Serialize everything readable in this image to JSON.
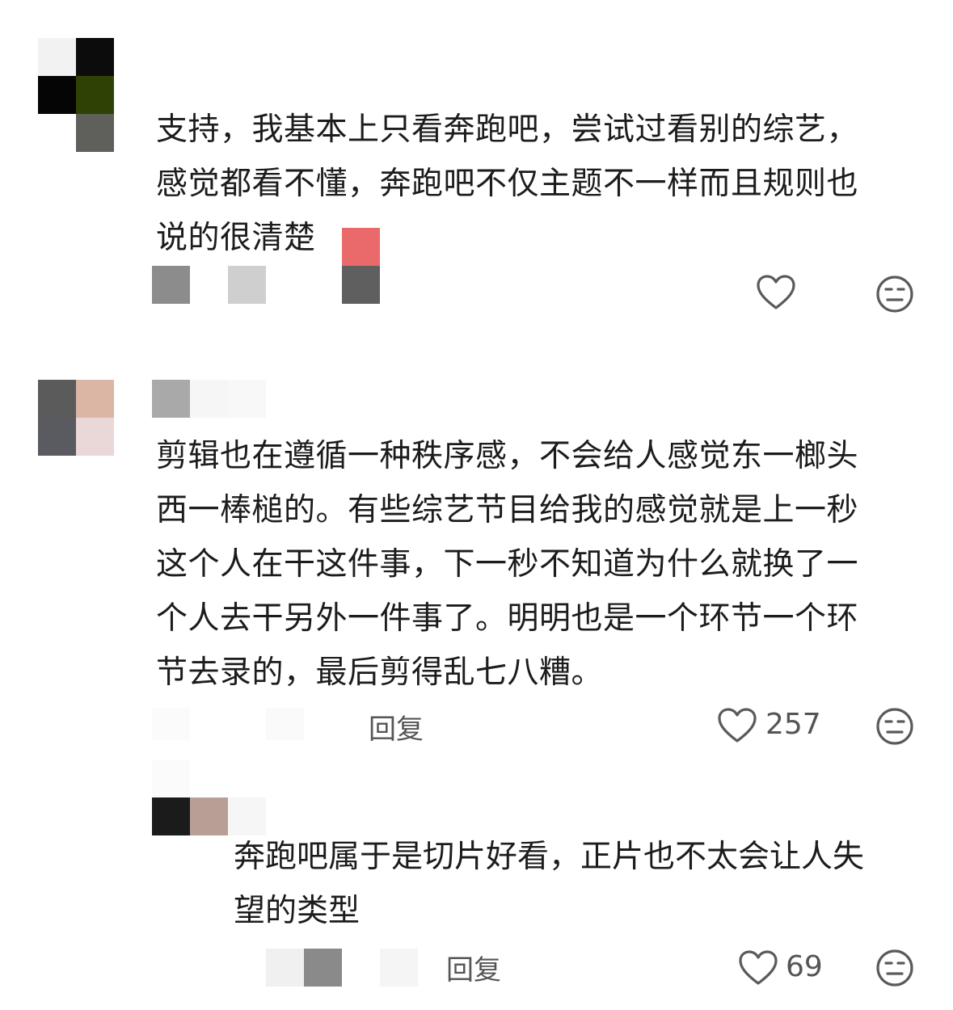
{
  "comments": [
    {
      "text": "支持，我基本上只看奔跑吧，尝试过看别的综艺，\n感觉都看不懂，奔跑吧不仅主题不一样而且规则也\n说的很清楚",
      "like_count": ""
    },
    {
      "text": "剪辑也在遵循一种秩序感，不会给人感觉东一榔头\n西一棒槌的。有些综艺节目给我的感觉就是上一秒\n这个人在干这件事，下一秒不知道为什么就换了一\n个人去干另外一件事了。明明也是一个环节一个环\n节去录的，最后剪得乱七八糟。",
      "reply_label": "回复",
      "like_count": "257",
      "replies": [
        {
          "text": "奔跑吧属于是切片好看，正片也不太会让人失\n望的类型",
          "reply_label": "回复",
          "like_count": "69"
        }
      ]
    }
  ],
  "colors": {
    "icon_stroke": "#5a5a5a",
    "text": "#1c1c1c",
    "meta_text": "#555555"
  },
  "icons": {
    "like": "heart-outline-icon",
    "dislike": "neutral-face-icon"
  }
}
